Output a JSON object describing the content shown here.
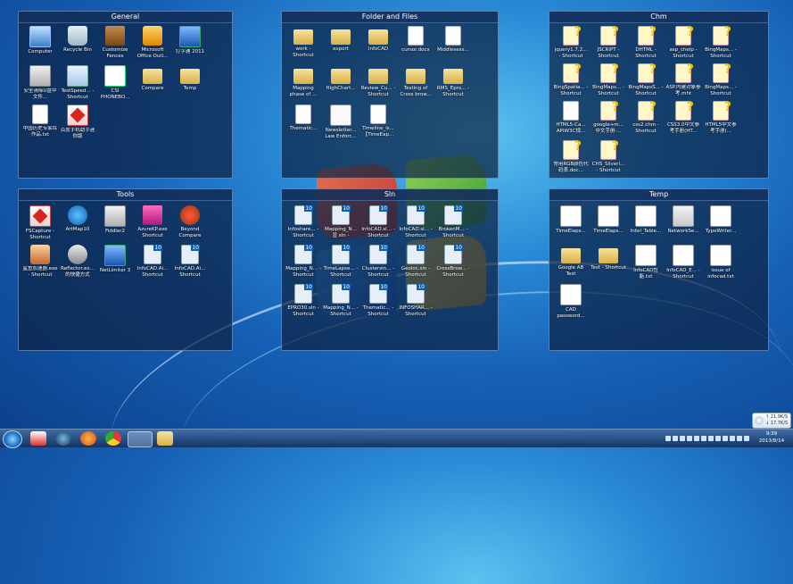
{
  "fences": {
    "general": {
      "title": "General",
      "items": [
        {
          "label": "Computer",
          "icon": "computer-icon"
        },
        {
          "label": "Recycle Bin",
          "icon": "recycle-bin-icon"
        },
        {
          "label": "Customize Fences",
          "icon": "fences-icon"
        },
        {
          "label": "Microsoft Office Outl...",
          "icon": "outlook-icon"
        },
        {
          "label": "打字通 2011",
          "icon": "app-icon"
        },
        {
          "label": "安全清除U盘中文件...",
          "icon": "usb-icon"
        },
        {
          "label": "TestSpeed... - Shortcut",
          "icon": "speed-icon"
        },
        {
          "label": "CSI PHONEBO...",
          "icon": "excel-icon"
        },
        {
          "label": "Compare",
          "icon": "folder-icon"
        },
        {
          "label": "Temp",
          "icon": "folder-icon"
        },
        {
          "label": "中国历史专家库作品.txt",
          "icon": "document-icon"
        },
        {
          "label": "百度手机助手迷你版",
          "icon": "baidu-icon"
        }
      ]
    },
    "folder_and_files": {
      "title": "Folder and Files",
      "items": [
        {
          "label": "work - Shortcut",
          "icon": "folder-icon"
        },
        {
          "label": "export",
          "icon": "folder-icon"
        },
        {
          "label": "InfoCAD",
          "icon": "folder-icon"
        },
        {
          "label": "cursor.docx",
          "icon": "document-icon"
        },
        {
          "label": "Middlesexs...",
          "icon": "document-icon"
        },
        {
          "label": "Mapping phase of ...",
          "icon": "folder-icon"
        },
        {
          "label": "HighChart...",
          "icon": "folder-icon"
        },
        {
          "label": "Review_Cu... - Shortcut",
          "icon": "folder-icon"
        },
        {
          "label": "Testing of Cross brow...",
          "icon": "folder-icon"
        },
        {
          "label": "RMS_Epro... - Shortcut",
          "icon": "folder-icon"
        },
        {
          "label": "Thematic...",
          "icon": "document-icon"
        },
        {
          "label": "Newsletter... Law Enforc...",
          "icon": "newsletter-icon"
        },
        {
          "label": "Timeline_is... 【TimeEap...",
          "icon": "document-icon"
        }
      ]
    },
    "chm": {
      "title": "Chm",
      "items": [
        {
          "label": "jquery1.7.2... - Shortcut",
          "icon": "chm-icon"
        },
        {
          "label": "JSCRIPT - Shortcut",
          "icon": "chm-icon"
        },
        {
          "label": "DHTML - Shortcut",
          "icon": "chm-icon"
        },
        {
          "label": "asp_chelp - Shortcut",
          "icon": "chm-icon"
        },
        {
          "label": "BingMaps... - Shortcut",
          "icon": "chm-icon"
        },
        {
          "label": "BingSpatia... - Shortcut",
          "icon": "chm-icon"
        },
        {
          "label": "BingMaps... - Shortcut",
          "icon": "chm-icon"
        },
        {
          "label": "BingMapsS... - Shortcut",
          "icon": "chm-icon"
        },
        {
          "label": "ASP.内建对象参考.mht",
          "icon": "chm-icon"
        },
        {
          "label": "BingMaps... - Shortcut",
          "icon": "chm-icon"
        },
        {
          "label": "HTML5-Ca... APIW3C规...",
          "icon": "document-icon"
        },
        {
          "label": "google+m... 中文手册-...",
          "icon": "chm-icon"
        },
        {
          "label": "css2.chm - Shortcut",
          "icon": "chm-icon"
        },
        {
          "label": "CSS3.0中文参考手册(HT...",
          "icon": "chm-icon"
        },
        {
          "label": "HTML5中文参考手册(...",
          "icon": "chm-icon"
        },
        {
          "label": "常用RGB颜色代码表.doc...",
          "icon": "chm-icon"
        },
        {
          "label": "CHS_Silverl... - Shortcut",
          "icon": "chm-icon"
        }
      ]
    },
    "tools": {
      "title": "Tools",
      "items": [
        {
          "label": "FSCapture - Shortcut",
          "icon": "fscapture-icon"
        },
        {
          "label": "ArtMap10",
          "icon": "globe-icon"
        },
        {
          "label": "Fiddler2",
          "icon": "fiddler-icon"
        },
        {
          "label": "AzureKP.exe Shortcut",
          "icon": "azure-icon"
        },
        {
          "label": "Beyond Compare",
          "icon": "beyond-compare-icon"
        },
        {
          "label": "鲨鱼加速器.exe - Shortcut",
          "icon": "accelerator-icon"
        },
        {
          "label": "Reflector.ex... 的快捷方式",
          "icon": "reflector-icon"
        },
        {
          "label": "NetLimiter 3",
          "icon": "netlimiter-icon"
        },
        {
          "label": "InfoCAD.Ai... Shortcut",
          "icon": "infocad-icon"
        },
        {
          "label": "InfoCAD.Ai... Shortcut",
          "icon": "infocad-icon"
        }
      ]
    },
    "sln": {
      "title": "Sln",
      "items": [
        {
          "label": "Infoshare... - Shortcut",
          "icon": "solution-icon"
        },
        {
          "label": "Mapping_N... 显 sln - Shortcut",
          "icon": "solution-icon"
        },
        {
          "label": "InfoCAD.sl... - Shortcut",
          "icon": "solution-icon"
        },
        {
          "label": "InfoCAD.sl... - Shortcut",
          "icon": "solution-icon"
        },
        {
          "label": "BrokenM... - Shortcut",
          "icon": "solution-icon"
        },
        {
          "label": "Mapping_N... - Shortcut",
          "icon": "solution-icon"
        },
        {
          "label": "TimeLapse... - Shortcut",
          "icon": "solution-icon"
        },
        {
          "label": "Clustersin... - Shortcut",
          "icon": "solution-icon"
        },
        {
          "label": "Geoloc.sln - Shortcut",
          "icon": "solution-icon"
        },
        {
          "label": "CrossBrow... - Shortcut",
          "icon": "solution-icon"
        },
        {
          "label": "EPRO30.sln - Shortcut",
          "icon": "solution-icon"
        },
        {
          "label": "Mapping_N... - Shortcut",
          "icon": "solution-icon"
        },
        {
          "label": "Thematic... - Shortcut",
          "icon": "solution-icon"
        },
        {
          "label": "INFOSHAR... - Shortcut",
          "icon": "solution-icon"
        }
      ]
    },
    "temp": {
      "title": "Temp",
      "items": [
        {
          "label": "TimeElaps...",
          "icon": "document-icon"
        },
        {
          "label": "TimeElaps...",
          "icon": "document-icon"
        },
        {
          "label": "Intel_Table...",
          "icon": "document-icon"
        },
        {
          "label": "NetworkSe...",
          "icon": "document-icon"
        },
        {
          "label": "TypeWriter...",
          "icon": "document-icon"
        },
        {
          "label": "Google AB Test",
          "icon": "folder-icon"
        },
        {
          "label": "Test - Shortcut",
          "icon": "folder-icon"
        },
        {
          "label": "InfoCAD性能.txt",
          "icon": "document-icon"
        },
        {
          "label": "InfoCAD_E... - Shortcut",
          "icon": "document-icon"
        },
        {
          "label": "issue of infocad.txt",
          "icon": "document-icon"
        },
        {
          "label": "CAD password...",
          "icon": "document-icon"
        }
      ]
    }
  },
  "weather": {
    "temp_high": "↑ 21.9K/S",
    "temp_low": "↓ 17.7K/S"
  },
  "clock": {
    "time": "9:39",
    "date": "2013/8/14"
  },
  "taskbar": {
    "items": [
      {
        "name": "app-icon-1"
      },
      {
        "name": "windows-media-icon"
      },
      {
        "name": "firefox-icon"
      },
      {
        "name": "chrome-icon"
      },
      {
        "name": "ie-icon"
      },
      {
        "name": "folder-icon"
      }
    ]
  }
}
